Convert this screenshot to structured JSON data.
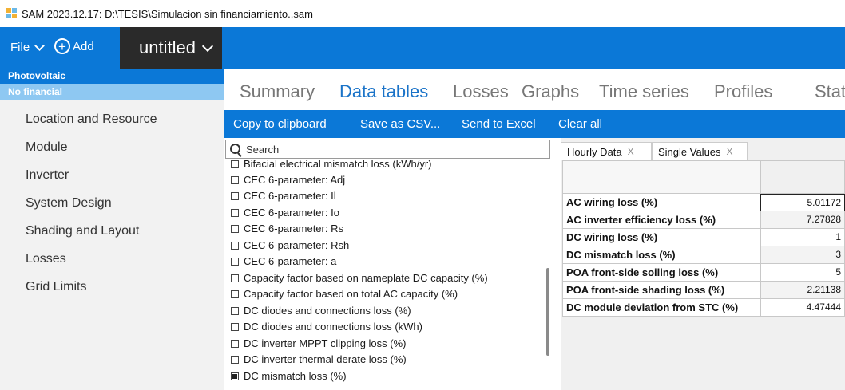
{
  "window": {
    "title": "SAM 2023.12.17: D:\\TESIS\\Simulacion sin financiamiento..sam"
  },
  "toolbar": {
    "file_label": "File",
    "add_label": "Add",
    "case_name": "untitled"
  },
  "sidebar": {
    "technology": "Photovoltaic",
    "financial": "No financial",
    "items": [
      "Location and Resource",
      "Module",
      "Inverter",
      "System Design",
      "Shading and Layout",
      "Losses",
      "Grid Limits"
    ]
  },
  "results_tabs": [
    "Summary",
    "Data tables",
    "Losses",
    "Graphs",
    "Time series",
    "Profiles",
    "Stat"
  ],
  "active_tab": "Data tables",
  "actions": [
    "Copy to clipboard",
    "Save as CSV...",
    "Send to Excel",
    "Clear all"
  ],
  "search": {
    "placeholder": "Search"
  },
  "variables": [
    {
      "label": "Bifacial electrical mismatch loss (kWh/yr)",
      "checked": false
    },
    {
      "label": "CEC 6-parameter: Adj",
      "checked": false
    },
    {
      "label": "CEC 6-parameter: Il",
      "checked": false
    },
    {
      "label": "CEC 6-parameter: Io",
      "checked": false
    },
    {
      "label": "CEC 6-parameter: Rs",
      "checked": false
    },
    {
      "label": "CEC 6-parameter: Rsh",
      "checked": false
    },
    {
      "label": "CEC 6-parameter: a",
      "checked": false
    },
    {
      "label": "Capacity factor based on nameplate DC capacity (%)",
      "checked": false
    },
    {
      "label": "Capacity factor based on total AC capacity (%)",
      "checked": false
    },
    {
      "label": "DC diodes and connections loss (%)",
      "checked": false
    },
    {
      "label": "DC diodes and connections loss (kWh)",
      "checked": false
    },
    {
      "label": "DC inverter MPPT clipping loss (%)",
      "checked": false
    },
    {
      "label": "DC inverter thermal derate loss (%)",
      "checked": false
    },
    {
      "label": "DC mismatch loss (%)",
      "checked": true
    }
  ],
  "subtabs": [
    {
      "label": "Hourly Data",
      "close": "X"
    },
    {
      "label": "Single Values",
      "close": "X"
    }
  ],
  "single_values": [
    {
      "label": "AC wiring loss (%)",
      "value": "5.01172"
    },
    {
      "label": "AC inverter efficiency loss (%)",
      "value": "7.27828"
    },
    {
      "label": "DC wiring loss (%)",
      "value": "1"
    },
    {
      "label": "DC mismatch loss (%)",
      "value": "3"
    },
    {
      "label": "POA front-side soiling loss (%)",
      "value": "5"
    },
    {
      "label": "POA front-side shading loss (%)",
      "value": "2.21138"
    },
    {
      "label": "DC module deviation from STC (%)",
      "value": "4.47444"
    }
  ],
  "colors": {
    "accent": "#0b78d7",
    "financial_band": "#8ec8f2",
    "case_tab": "#2a2a2a",
    "active_tab_text": "#1a73c8"
  }
}
